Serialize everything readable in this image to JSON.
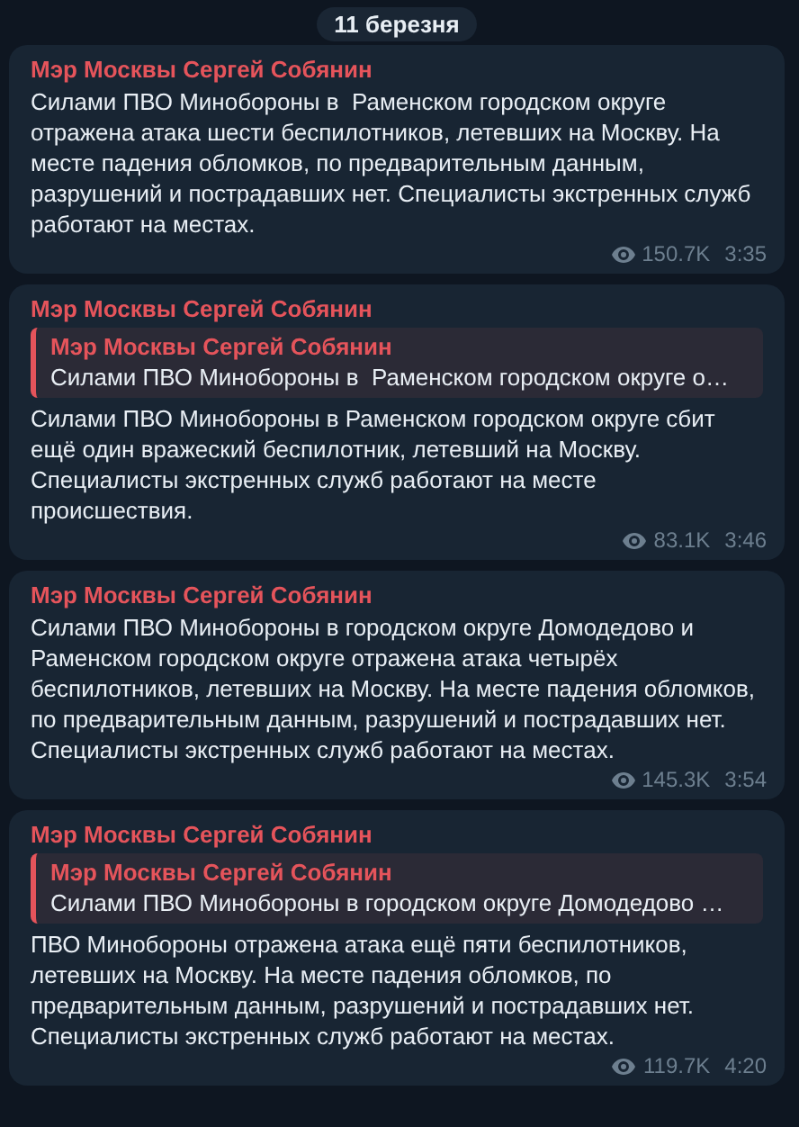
{
  "date_separator": "11 березня",
  "messages": [
    {
      "sender": "Мэр Москвы Сергей Собянин",
      "text": "Силами ПВО Минобороны в  Раменском городском округе отражена атака шести беспилотников, летевших на Москву. На месте падения обломков, по предварительным данным, разрушений и пострадавших нет. Специалисты экстренных служб работают на местах.",
      "views": "150.7K",
      "time": "3:35"
    },
    {
      "sender": "Мэр Москвы Сергей Собянин",
      "reply": {
        "sender": "Мэр Москвы Сергей Собянин",
        "text": "Силами ПВО Минобороны в  Раменском городском округе о…"
      },
      "text": "Силами ПВО Минобороны в Раменском городском округе сбит ещё один вражеский беспилотник, летевший на Москву. Специалисты экстренных служб работают на месте происшествия.",
      "views": "83.1K",
      "time": "3:46"
    },
    {
      "sender": "Мэр Москвы Сергей Собянин",
      "text": "Силами ПВО Минобороны в городском округе Домодедово и Раменском городском округе отражена атака четырёх беспилотников, летевших на Москву. На месте падения обломков, по предварительным данным, разрушений и пострадавших нет. Специалисты экстренных служб работают на местах.",
      "views": "145.3K",
      "time": "3:54"
    },
    {
      "sender": "Мэр Москвы Сергей Собянин",
      "reply": {
        "sender": "Мэр Москвы Сергей Собянин",
        "text": "Силами ПВО Минобороны в городском округе Домодедово …"
      },
      "text": "ПВО Минобороны отражена атака ещё пяти беспилотников, летевших на Москву. На месте падения обломков, по предварительным данным, разрушений и пострадавших нет. Специалисты экстренных служб работают на местах.",
      "views": "119.7K",
      "time": "4:20"
    }
  ]
}
